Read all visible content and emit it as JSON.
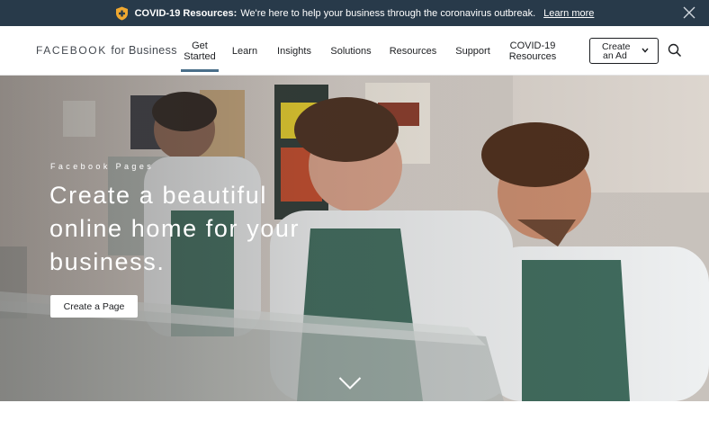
{
  "banner": {
    "icon": "shield-plus-icon",
    "bold": "COVID-19 Resources:",
    "message": "We're here to help your business through the coronavirus outbreak.",
    "link": "Learn more",
    "close_icon": "close-icon",
    "background": "#283a4a",
    "shield_color": "#f0a830"
  },
  "nav": {
    "brand_bold": "FACEBOOK",
    "brand_rest": "for Business",
    "items": [
      {
        "line1": "Get",
        "line2": "Started",
        "active": true
      },
      {
        "line1": "Learn",
        "line2": ""
      },
      {
        "line1": "Insights",
        "line2": ""
      },
      {
        "line1": "Solutions",
        "line2": ""
      },
      {
        "line1": "Resources",
        "line2": ""
      },
      {
        "line1": "Support",
        "line2": ""
      },
      {
        "line1": "COVID-19",
        "line2": "Resources"
      }
    ],
    "cta_line1": "Create",
    "cta_line2": "an Ad",
    "cta_icon": "chevron-down-icon",
    "search_icon": "search-icon",
    "active_color": "#4a6f8a"
  },
  "hero": {
    "eyebrow": "Facebook Pages",
    "headline": "Create a beautiful online home for your business.",
    "button": "Create a Page",
    "scroll_icon": "chevron-down-icon"
  }
}
